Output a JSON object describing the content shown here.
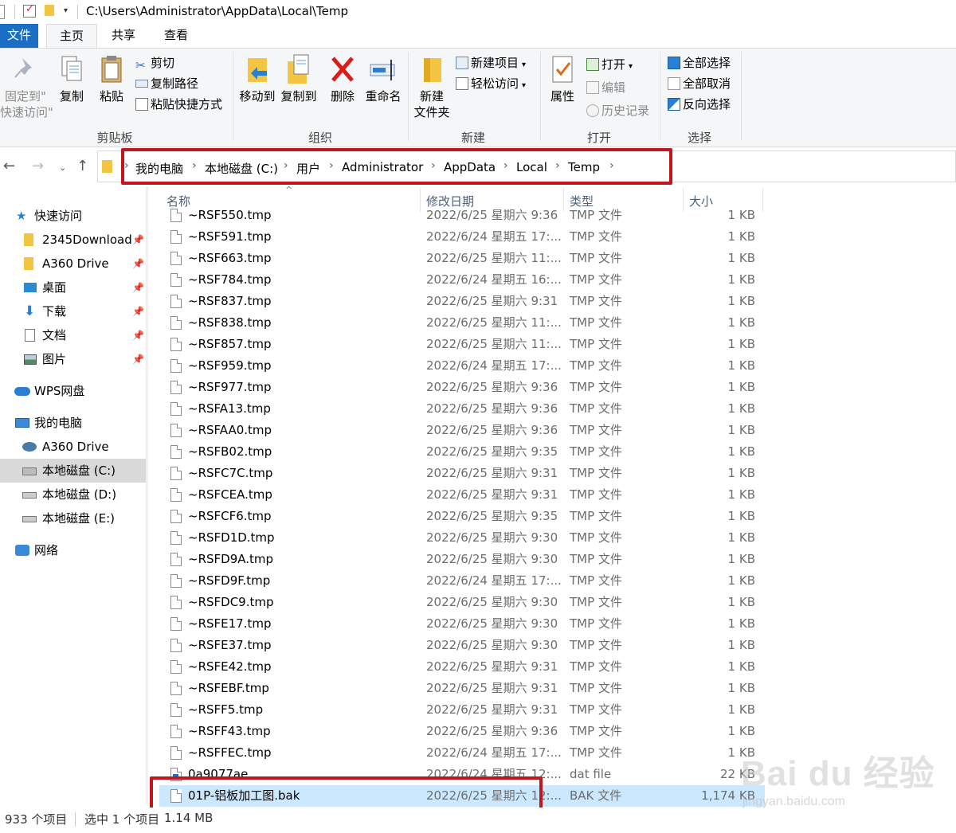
{
  "window": {
    "path": "C:\\Users\\Administrator\\AppData\\Local\\Temp"
  },
  "tabs": {
    "file": "文件",
    "home": "主页",
    "share": "共享",
    "view": "查看"
  },
  "ribbon": {
    "clipboard": {
      "label": "剪贴板",
      "pin_line1": "固定到\"",
      "pin_line2": "快速访问\"",
      "copy": "复制",
      "paste": "粘贴",
      "cut": "剪切",
      "copy_path": "复制路径",
      "paste_shortcut": "粘贴快捷方式"
    },
    "organize": {
      "label": "组织",
      "move_to": "移动到",
      "copy_to": "复制到",
      "delete": "删除",
      "rename": "重命名"
    },
    "new": {
      "label": "新建",
      "new_folder_line1": "新建",
      "new_folder_line2": "文件夹",
      "new_item": "新建项目",
      "easy_access": "轻松访问"
    },
    "open": {
      "label": "打开",
      "properties": "属性",
      "open": "打开",
      "edit": "编辑",
      "history": "历史记录"
    },
    "select": {
      "label": "选择",
      "select_all": "全部选择",
      "select_none": "全部取消",
      "invert": "反向选择"
    }
  },
  "breadcrumb": [
    "我的电脑",
    "本地磁盘 (C:)",
    "用户",
    "Administrator",
    "AppData",
    "Local",
    "Temp"
  ],
  "nav": {
    "quick_access": "快速访问",
    "items": [
      "2345Download",
      "A360 Drive",
      "桌面",
      "下载",
      "文档",
      "图片"
    ],
    "wps": "WPS网盘",
    "this_pc": "我的电脑",
    "pc_items": [
      "A360 Drive",
      "本地磁盘 (C:)",
      "本地磁盘 (D:)",
      "本地磁盘 (E:)"
    ],
    "network": "网络"
  },
  "columns": {
    "name": "名称",
    "date": "修改日期",
    "type": "类型",
    "size": "大小"
  },
  "files": [
    {
      "name": "~RSF550.tmp",
      "date": "2022/6/25 星期六 9:36",
      "type": "TMP 文件",
      "size": "1 KB"
    },
    {
      "name": "~RSF591.tmp",
      "date": "2022/6/24 星期五 17:...",
      "type": "TMP 文件",
      "size": "1 KB"
    },
    {
      "name": "~RSF663.tmp",
      "date": "2022/6/25 星期六 11:...",
      "type": "TMP 文件",
      "size": "1 KB"
    },
    {
      "name": "~RSF784.tmp",
      "date": "2022/6/24 星期五 16:...",
      "type": "TMP 文件",
      "size": "1 KB"
    },
    {
      "name": "~RSF837.tmp",
      "date": "2022/6/25 星期六 9:31",
      "type": "TMP 文件",
      "size": "1 KB"
    },
    {
      "name": "~RSF838.tmp",
      "date": "2022/6/25 星期六 11:...",
      "type": "TMP 文件",
      "size": "1 KB"
    },
    {
      "name": "~RSF857.tmp",
      "date": "2022/6/25 星期六 11:...",
      "type": "TMP 文件",
      "size": "1 KB"
    },
    {
      "name": "~RSF959.tmp",
      "date": "2022/6/24 星期五 17:...",
      "type": "TMP 文件",
      "size": "1 KB"
    },
    {
      "name": "~RSF977.tmp",
      "date": "2022/6/25 星期六 9:36",
      "type": "TMP 文件",
      "size": "1 KB"
    },
    {
      "name": "~RSFA13.tmp",
      "date": "2022/6/25 星期六 9:36",
      "type": "TMP 文件",
      "size": "1 KB"
    },
    {
      "name": "~RSFAA0.tmp",
      "date": "2022/6/25 星期六 9:36",
      "type": "TMP 文件",
      "size": "1 KB"
    },
    {
      "name": "~RSFB02.tmp",
      "date": "2022/6/25 星期六 9:35",
      "type": "TMP 文件",
      "size": "1 KB"
    },
    {
      "name": "~RSFC7C.tmp",
      "date": "2022/6/25 星期六 9:31",
      "type": "TMP 文件",
      "size": "1 KB"
    },
    {
      "name": "~RSFCEA.tmp",
      "date": "2022/6/25 星期六 9:31",
      "type": "TMP 文件",
      "size": "1 KB"
    },
    {
      "name": "~RSFCF6.tmp",
      "date": "2022/6/25 星期六 9:35",
      "type": "TMP 文件",
      "size": "1 KB"
    },
    {
      "name": "~RSFD1D.tmp",
      "date": "2022/6/25 星期六 9:30",
      "type": "TMP 文件",
      "size": "1 KB"
    },
    {
      "name": "~RSFD9A.tmp",
      "date": "2022/6/25 星期六 9:30",
      "type": "TMP 文件",
      "size": "1 KB"
    },
    {
      "name": "~RSFD9F.tmp",
      "date": "2022/6/24 星期五 17:...",
      "type": "TMP 文件",
      "size": "1 KB"
    },
    {
      "name": "~RSFDC9.tmp",
      "date": "2022/6/25 星期六 9:30",
      "type": "TMP 文件",
      "size": "1 KB"
    },
    {
      "name": "~RSFE17.tmp",
      "date": "2022/6/25 星期六 9:30",
      "type": "TMP 文件",
      "size": "1 KB"
    },
    {
      "name": "~RSFE37.tmp",
      "date": "2022/6/25 星期六 9:30",
      "type": "TMP 文件",
      "size": "1 KB"
    },
    {
      "name": "~RSFE42.tmp",
      "date": "2022/6/25 星期六 9:31",
      "type": "TMP 文件",
      "size": "1 KB"
    },
    {
      "name": "~RSFEBF.tmp",
      "date": "2022/6/25 星期六 9:31",
      "type": "TMP 文件",
      "size": "1 KB"
    },
    {
      "name": "~RSFF5.tmp",
      "date": "2022/6/25 星期六 9:31",
      "type": "TMP 文件",
      "size": "1 KB"
    },
    {
      "name": "~RSFF43.tmp",
      "date": "2022/6/25 星期六 9:36",
      "type": "TMP 文件",
      "size": "1 KB"
    },
    {
      "name": "~RSFFEC.tmp",
      "date": "2022/6/24 星期五 17:...",
      "type": "TMP 文件",
      "size": "1 KB"
    },
    {
      "name": "0a9077ae",
      "date": "2022/6/24 星期五 12:...",
      "type": "dat file",
      "size": "22 KB"
    },
    {
      "name": "01P-铝板加工图.bak",
      "date": "2022/6/25 星期六 12:...",
      "type": "BAK 文件",
      "size": "1,174 KB"
    }
  ],
  "selected_index": 27,
  "status": {
    "count": "933 个项目",
    "selected": "选中 1 个项目",
    "size": "1.14 MB"
  },
  "watermark": {
    "brand": "Bai du 经验",
    "url": "jingyan.baidu.com"
  },
  "colors": {
    "accent": "#1a6fc4",
    "highlight_box": "#c0171c",
    "selection": "#cce8ff"
  }
}
